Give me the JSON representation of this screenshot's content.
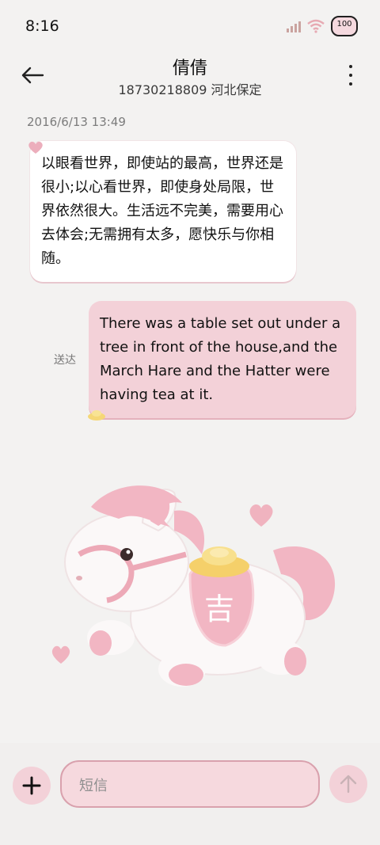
{
  "status_bar": {
    "time": "8:16",
    "battery_level": "100"
  },
  "header": {
    "contact_name": "倩倩",
    "contact_subtitle": "18730218809 河北保定"
  },
  "conversation": {
    "timestamp": "2016/6/13 13:49",
    "incoming_message": "以眼看世界，即使站的最高，世界还是很小;以心看世界，即使身处局限，世界依然很大。生活远不完美，需要用心去体会;无需拥有太多，愿快乐与你相随。",
    "outgoing_message": "There was a table set out under a tree in front of the house,and the March Hare and the Hatter were having tea at it.",
    "outgoing_status": "送达"
  },
  "compose": {
    "placeholder": "短信"
  },
  "colors": {
    "accent_pink": "#f3d1d8",
    "input_border": "#d9a1ad",
    "background": "#f3f2f1"
  },
  "icons": {
    "back": "arrow-left-icon",
    "more": "more-vertical-icon",
    "add": "plus-icon",
    "send": "arrow-up-icon"
  }
}
